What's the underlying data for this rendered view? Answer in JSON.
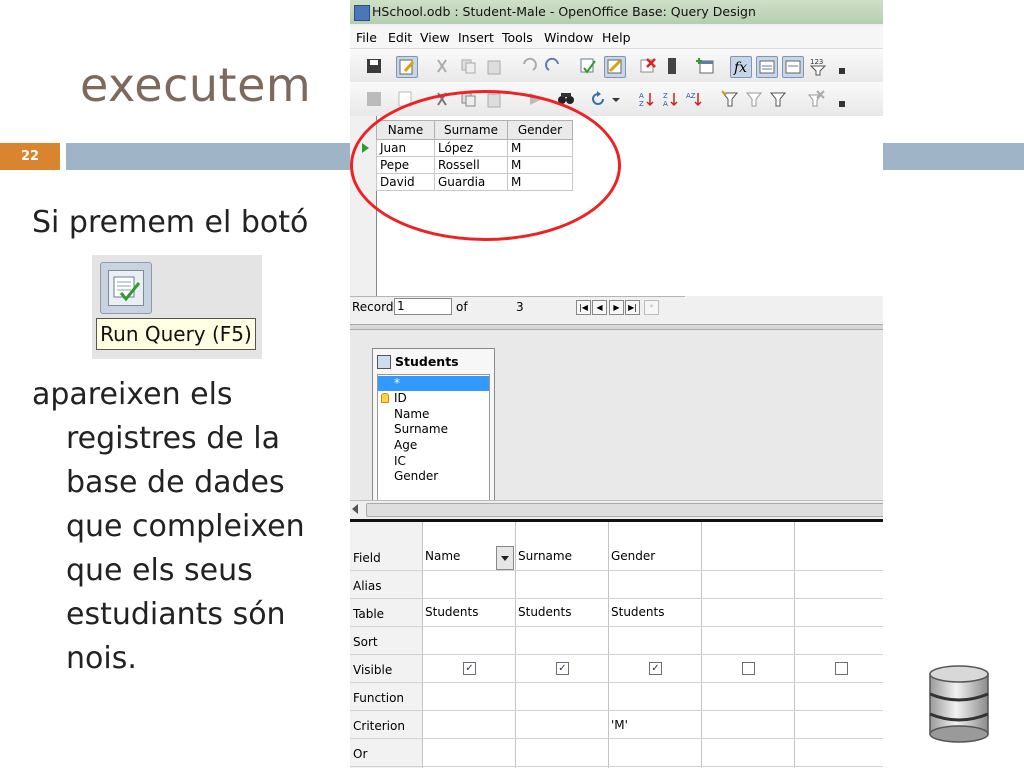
{
  "slide": {
    "title": "executem",
    "number": "22",
    "line1": "Si premem el botó",
    "para": [
      "apareixen els",
      "registres de la",
      "base de dades",
      "que compleixen",
      "que els seus",
      "estudiants són",
      "nois."
    ],
    "tooltip": "Run Query (F5)",
    "accent_color": "#d9842f",
    "band_color": "#9fb4c6"
  },
  "window": {
    "title": "HSchool.odb : Student-Male - OpenOffice Base: Query Design",
    "menu": [
      "File",
      "Edit",
      "View",
      "Insert",
      "Tools",
      "Window",
      "Help"
    ]
  },
  "results": {
    "columns": [
      "Name",
      "Surname",
      "Gender"
    ],
    "rows": [
      [
        "Juan",
        "López",
        "M"
      ],
      [
        "Pepe",
        "Rossell",
        "M"
      ],
      [
        "David",
        "Guardia",
        "M"
      ]
    ]
  },
  "record_bar": {
    "label": "Record",
    "current": "1",
    "of_label": "of",
    "total": "3"
  },
  "table_window": {
    "name": "Students",
    "fields": [
      "*",
      "ID",
      "Name",
      "Surname",
      "Age",
      "IC",
      "Gender"
    ]
  },
  "design_grid": {
    "row_labels": [
      "Field",
      "Alias",
      "Table",
      "Sort",
      "Visible",
      "Function",
      "Criterion",
      "Or"
    ],
    "columns": [
      {
        "field": "Name",
        "table": "Students",
        "visible": true,
        "criterion": ""
      },
      {
        "field": "Surname",
        "table": "Students",
        "visible": true,
        "criterion": ""
      },
      {
        "field": "Gender",
        "table": "Students",
        "visible": true,
        "criterion": "'M'"
      },
      {
        "field": "",
        "table": "",
        "visible": false,
        "criterion": ""
      },
      {
        "field": "",
        "table": "",
        "visible": false,
        "criterion": ""
      }
    ]
  }
}
